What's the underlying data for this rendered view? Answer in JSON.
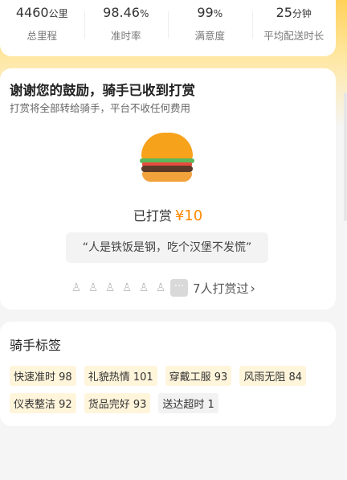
{
  "stats": [
    {
      "num": "4460",
      "unit": "公里",
      "label": "总里程"
    },
    {
      "num": "98.46",
      "unit": "%",
      "label": "准时率"
    },
    {
      "num": "99",
      "unit": "%",
      "label": "满意度"
    },
    {
      "num": "25",
      "unit": "分钟",
      "label": "平均配送时长"
    }
  ],
  "reward": {
    "title": "谢谢您的鼓励，骑手已收到打赏",
    "subtitle": "打赏将全部转给骑手，平台不收任何费用",
    "tipped_label": "已打赏",
    "amount": "¥10",
    "quote": "“人是铁饭是钢，吃个汉堡不发慌”",
    "more_icon": "···",
    "tip_count": "7人打赏过",
    "chevron": "›"
  },
  "tags": {
    "title": "骑手标签",
    "items": [
      {
        "label": "快速准时 98"
      },
      {
        "label": "礼貌热情 101"
      },
      {
        "label": "穿戴工服 93"
      },
      {
        "label": "风雨无阻 84"
      },
      {
        "label": "仪表整洁 92"
      },
      {
        "label": "货品完好 93"
      },
      {
        "label": "送达超时 1"
      }
    ]
  }
}
